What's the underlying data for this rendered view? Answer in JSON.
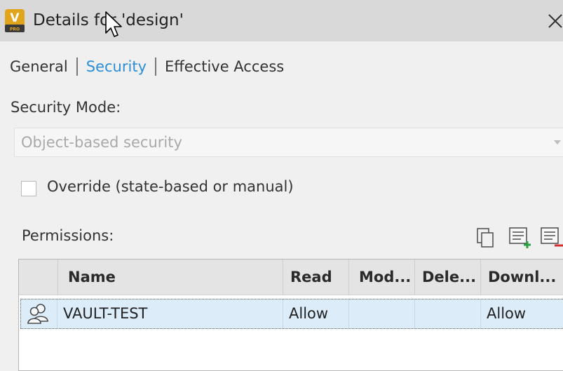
{
  "window": {
    "title": "Details for 'design'",
    "app_icon": "vault-pro-icon",
    "app_icon_letter": "V",
    "app_icon_sub": "PRO",
    "close_icon": "close-icon"
  },
  "tabs": [
    {
      "label": "General",
      "active": false
    },
    {
      "label": "Security",
      "active": true
    },
    {
      "label": "Effective Access",
      "active": false
    }
  ],
  "security_mode": {
    "label": "Security Mode:",
    "value": "Object-based security",
    "disabled": true
  },
  "override": {
    "label": "Override (state-based or manual)",
    "checked": false
  },
  "permissions": {
    "label": "Permissions:",
    "toolbar": [
      "copy-icon",
      "add-entry-icon",
      "remove-entry-icon"
    ],
    "columns": [
      "Name",
      "Read",
      "Mod...",
      "Dele...",
      "Downl..."
    ],
    "rows": [
      {
        "icon": "group-user-icon",
        "name": "VAULT-TEST",
        "read": "Allow",
        "modify": "",
        "delete": "",
        "download": "Allow"
      }
    ]
  },
  "colors": {
    "accent": "#2c8ed6",
    "selected_row": "#dcecf9",
    "title_bar": "#d9d9d9",
    "app_icon_bg": "#e1a51c"
  }
}
